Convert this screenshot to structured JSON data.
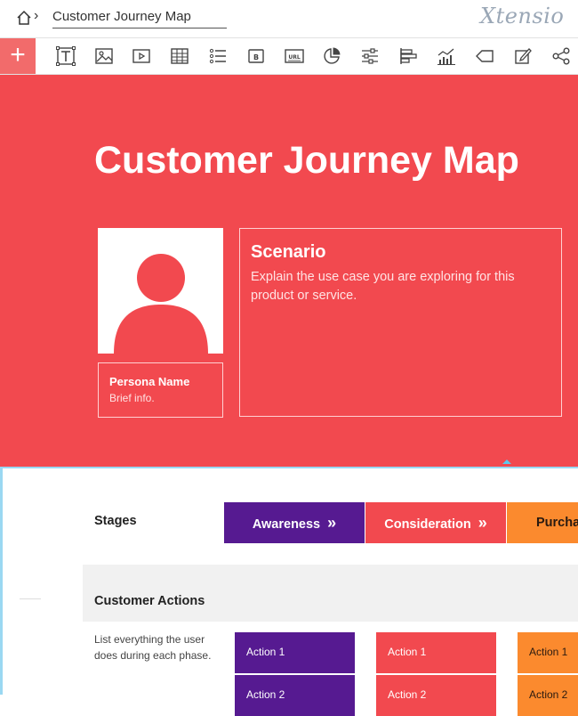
{
  "header": {
    "title": "Customer Journey Map",
    "logo": "Xtensio"
  },
  "toolbar": {
    "add_label": "+",
    "icons": [
      "text-icon",
      "image-icon",
      "video-icon",
      "table-icon",
      "list-icon",
      "button-icon",
      "url-icon",
      "pie-chart-icon",
      "sliders-icon",
      "bar-chart-icon",
      "line-chart-icon",
      "tag-icon",
      "edit-icon",
      "share-icon"
    ],
    "button_text": "B",
    "url_text": "URL"
  },
  "colors": {
    "hero": "#f2494f",
    "awareness": "#561a91",
    "consideration": "#f2494f",
    "purchase": "#fb8a2e",
    "accent": "#f26b6b"
  },
  "hero": {
    "title": "Customer Journey Map",
    "persona": {
      "name": "Persona Name",
      "info": "Brief info."
    },
    "scenario": {
      "title": "Scenario",
      "description": "Explain the use case you are exploring for this product or service."
    }
  },
  "journey": {
    "stages_label": "Stages",
    "stages": [
      {
        "label": "Awareness",
        "arrow": "»"
      },
      {
        "label": "Consideration",
        "arrow": "»"
      },
      {
        "label": "Purcha",
        "arrow": ""
      }
    ],
    "actions_label": "Customer Actions",
    "actions_desc": "List everything the user does during each phase.",
    "actions": [
      [
        "Action 1",
        "Action 2"
      ],
      [
        "Action 1",
        "Action 2"
      ],
      [
        "Action 1",
        "Action 2"
      ]
    ]
  }
}
